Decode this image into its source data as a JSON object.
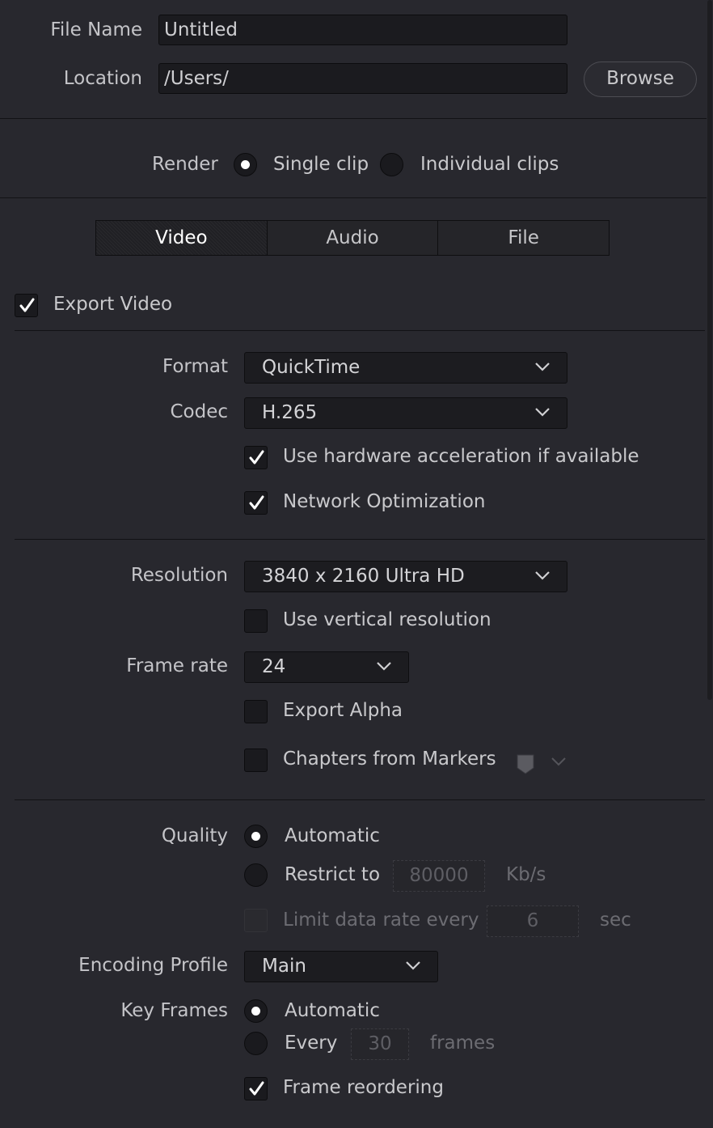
{
  "file": {
    "file_name_label": "File Name",
    "file_name_value": "Untitled",
    "location_label": "Location",
    "location_value": "/Users/",
    "browse_label": "Browse"
  },
  "render": {
    "label": "Render",
    "single_clip": "Single clip",
    "individual_clips": "Individual clips",
    "selected": "single_clip"
  },
  "tabs": [
    {
      "label": "Video",
      "active": true
    },
    {
      "label": "Audio",
      "active": false
    },
    {
      "label": "File",
      "active": false
    }
  ],
  "video": {
    "export_video_label": "Export Video",
    "export_video_checked": true,
    "format_label": "Format",
    "format_value": "QuickTime",
    "codec_label": "Codec",
    "codec_value": "H.265",
    "hw_accel_label": "Use hardware acceleration if available",
    "hw_accel_checked": true,
    "network_opt_label": "Network Optimization",
    "network_opt_checked": true,
    "resolution_label": "Resolution",
    "resolution_value": "3840 x 2160 Ultra HD",
    "vertical_res_label": "Use vertical resolution",
    "vertical_res_checked": false,
    "frame_rate_label": "Frame rate",
    "frame_rate_value": "24",
    "export_alpha_label": "Export Alpha",
    "export_alpha_checked": false,
    "chapters_label": "Chapters from Markers",
    "chapters_checked": false,
    "quality_label": "Quality",
    "quality_automatic": "Automatic",
    "quality_restrict": "Restrict to",
    "quality_restrict_value": "80000",
    "quality_unit": "Kb/s",
    "limit_rate_label": "Limit data rate every",
    "limit_rate_value": "6",
    "limit_rate_unit": "sec",
    "encoding_profile_label": "Encoding Profile",
    "encoding_profile_value": "Main",
    "key_frames_label": "Key Frames",
    "key_frames_automatic": "Automatic",
    "key_frames_every": "Every",
    "key_frames_every_value": "30",
    "key_frames_unit": "frames",
    "frame_reorder_label": "Frame reordering",
    "frame_reorder_checked": true
  },
  "colors": {
    "background": "#28282e",
    "field": "#1b1b1f",
    "accent_white": "#ffffff"
  }
}
